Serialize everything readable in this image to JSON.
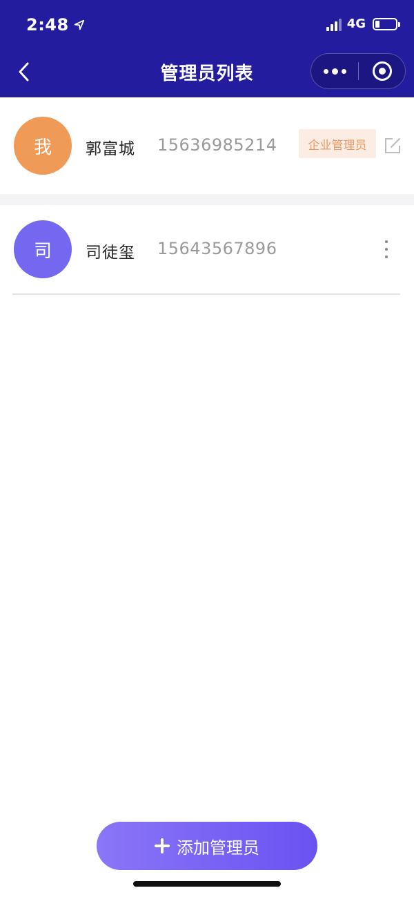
{
  "status_bar": {
    "time": "2:48",
    "network": "4G"
  },
  "nav": {
    "title": "管理员列表"
  },
  "admins": [
    {
      "avatar_text": "我",
      "name": "郭富城",
      "phone": "15636985214",
      "role_badge": "企业管理员",
      "action_icon": "edit-icon"
    },
    {
      "avatar_text": "司",
      "name": "司徒玺",
      "phone": "15643567896",
      "action_icon": "more-vertical-icon"
    }
  ],
  "add_button": {
    "label": "添加管理员"
  },
  "colors": {
    "header_bg": "#231c9f",
    "avatar_self": "#ef9a56",
    "avatar_other": "#7368ef",
    "badge_bg": "#fbede3",
    "badge_text": "#ee9a62",
    "button_gradient_start": "#8a76f7",
    "button_gradient_end": "#6a52f2"
  }
}
